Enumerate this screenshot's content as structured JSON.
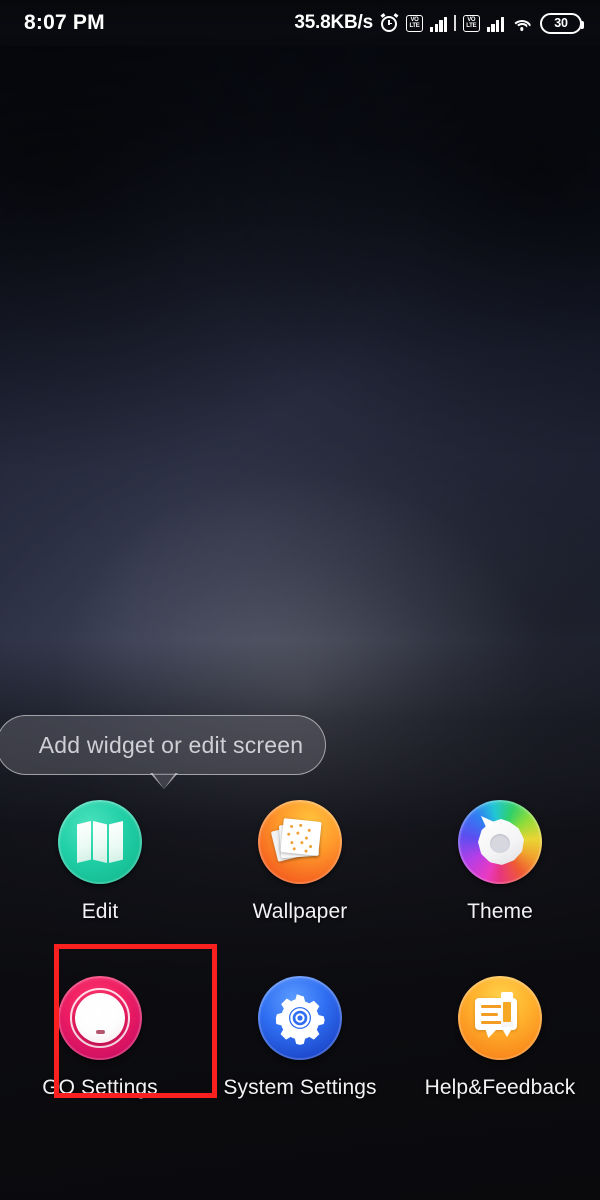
{
  "status_bar": {
    "time": "8:07 PM",
    "network_speed": "35.8KB/s",
    "alarm_icon": "alarm-clock-icon",
    "sim1_label": "VoLTE",
    "sim1_top": "VO",
    "sim1_bottom": "LTE",
    "sim2_label": "VoLTE",
    "sim2_top": "VO",
    "sim2_bottom": "LTE",
    "wifi_icon": "wifi-icon",
    "battery_percent": "30"
  },
  "tooltip": {
    "text": "Add widget or edit screen"
  },
  "menu": {
    "items": [
      {
        "label": "Edit",
        "icon": "map-pages-icon",
        "color": "#20cfa6"
      },
      {
        "label": "Wallpaper",
        "icon": "photo-stack-icon",
        "color": "#f4601f"
      },
      {
        "label": "Theme",
        "icon": "color-wheel-icon",
        "color": "#e93ac0"
      },
      {
        "label": "GO Settings",
        "icon": "dial-knob-icon",
        "color": "#ef1e63"
      },
      {
        "label": "System Settings",
        "icon": "gear-icon",
        "color": "#2f6ef2"
      },
      {
        "label": "Help&Feedback",
        "icon": "speech-pencil-icon",
        "color": "#ffb02c"
      }
    ]
  },
  "annotation": {
    "target": "GO Settings",
    "color": "#fa2020"
  }
}
